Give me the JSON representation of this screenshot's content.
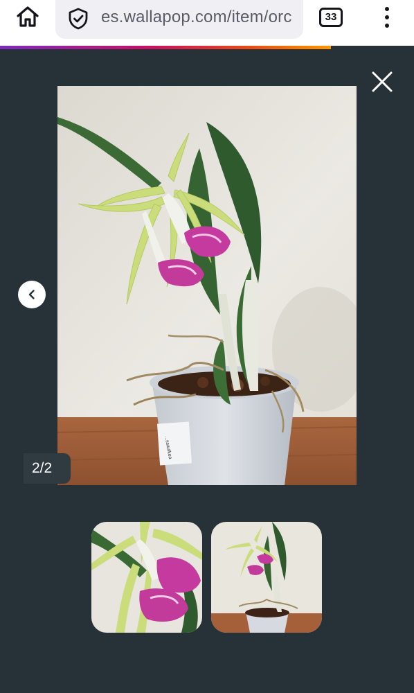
{
  "browser": {
    "url": "es.wallapop.com/item/orc",
    "tab_count": "33",
    "icons": {
      "home": "home-icon",
      "security": "shield-check-icon",
      "menu": "kebab-menu-icon"
    },
    "progress_color_start": "#7b2cbf",
    "progress_color_end": "#ff9800"
  },
  "viewer": {
    "background": "#263238",
    "counter": "2/2",
    "pot_label": "...ssaulkea",
    "icons": {
      "close": "close-icon",
      "previous": "chevron-left-icon"
    },
    "thumbnails": [
      {
        "name": "thumbnail-1"
      },
      {
        "name": "thumbnail-2"
      }
    ]
  }
}
